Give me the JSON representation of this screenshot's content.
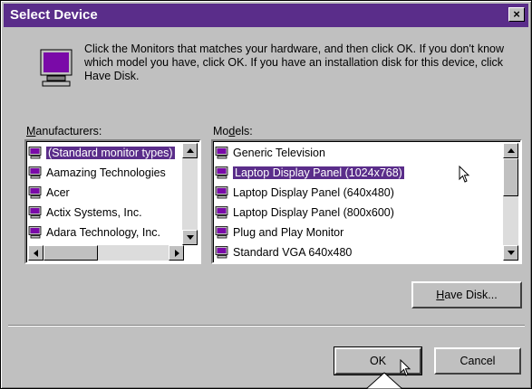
{
  "dialog": {
    "title": "Select Device",
    "close_glyph": "×",
    "intro_text": "Click the Monitors that matches your hardware, and then click OK. If you don't know which model you have, click OK. If you have an installation disk for this device, click Have Disk.",
    "icon": "monitor-icon"
  },
  "manufacturers": {
    "label_first": "M",
    "label_rest": "anufacturers:",
    "selected_index": 0,
    "items": [
      {
        "label": "(Standard monitor types)"
      },
      {
        "label": "Aamazing Technologies"
      },
      {
        "label": "Acer"
      },
      {
        "label": "Actix Systems, Inc."
      },
      {
        "label": "Adara Technology, Inc."
      }
    ]
  },
  "models": {
    "label_first": "Mo",
    "label_u": "d",
    "label_rest": "els:",
    "selected_index": 1,
    "items": [
      {
        "label": "Generic Television"
      },
      {
        "label": "Laptop Display Panel (1024x768)"
      },
      {
        "label": "Laptop Display Panel (640x480)"
      },
      {
        "label": "Laptop Display Panel (800x600)"
      },
      {
        "label": "Plug and Play Monitor"
      },
      {
        "label": "Standard VGA 640x480"
      }
    ]
  },
  "buttons": {
    "have_disk_u": "H",
    "have_disk_rest": "ave Disk...",
    "ok": "OK",
    "cancel": "Cancel"
  },
  "colors": {
    "titlebar": "#5a2d8a",
    "selection": "#5a2d8a",
    "face": "#c0c0c0"
  }
}
